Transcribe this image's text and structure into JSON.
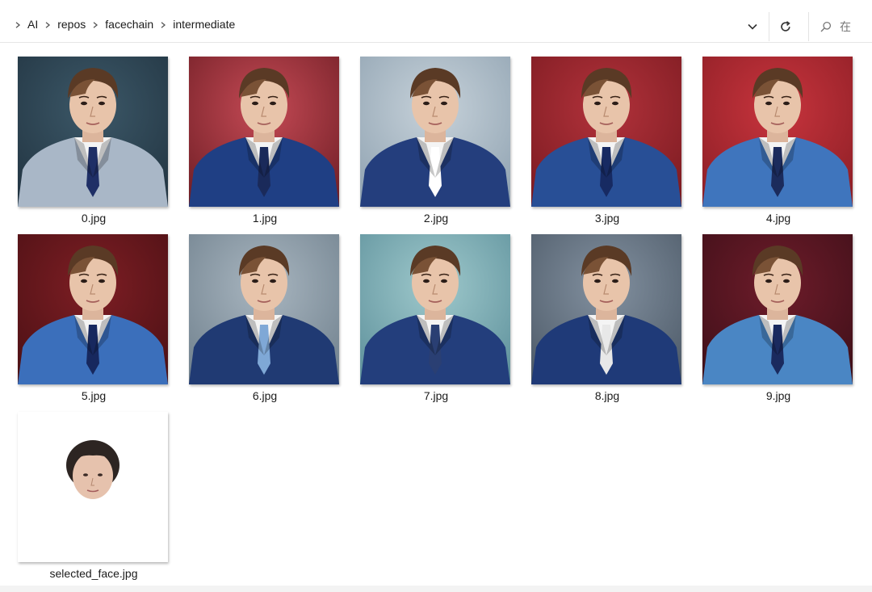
{
  "breadcrumb": [
    "AI",
    "repos",
    "facechain",
    "intermediate"
  ],
  "search": {
    "placeholder": "在"
  },
  "files": [
    {
      "name": "0.jpg",
      "bg": "#3c5868",
      "bg2": "#213340",
      "suit": "#a9b7c7",
      "tie": "#1f2f66"
    },
    {
      "name": "1.jpg",
      "bg": "#c54a55",
      "bg2": "#6d1d24",
      "suit": "#1f3f84",
      "tie": "#1a2a5a"
    },
    {
      "name": "2.jpg",
      "bg": "#c7d2da",
      "bg2": "#8ea1b0",
      "suit": "#243e7d",
      "tie": "#ffffff"
    },
    {
      "name": "3.jpg",
      "bg": "#b2323b",
      "bg2": "#7a1a20",
      "suit": "#284f96",
      "tie": "#172a62"
    },
    {
      "name": "4.jpg",
      "bg": "#c8343d",
      "bg2": "#8b1e25",
      "suit": "#3f75bd",
      "tie": "#1b2b5c"
    },
    {
      "name": "5.jpg",
      "bg": "#7e1e24",
      "bg2": "#4a1014",
      "suit": "#3b6fbb",
      "tie": "#17285e"
    },
    {
      "name": "6.jpg",
      "bg": "#a9b6c0",
      "bg2": "#6e7f8c",
      "suit": "#203a73",
      "tie": "#7fa8d6"
    },
    {
      "name": "7.jpg",
      "bg": "#9fc9cc",
      "bg2": "#5c8f9a",
      "suit": "#233e7c",
      "tie": "#2a3f73"
    },
    {
      "name": "8.jpg",
      "bg": "#8391a0",
      "bg2": "#4b5866",
      "suit": "#1f3a78",
      "tie": "#e8e8e8"
    },
    {
      "name": "9.jpg",
      "bg": "#6e1c2a",
      "bg2": "#3d0f18",
      "suit": "#4a86c4",
      "tie": "#1a2a5e"
    },
    {
      "name": "selected_face.jpg",
      "bg": "#ffffff",
      "bg2": "#ffffff",
      "suit": "",
      "tie": "",
      "face_only": true
    }
  ]
}
